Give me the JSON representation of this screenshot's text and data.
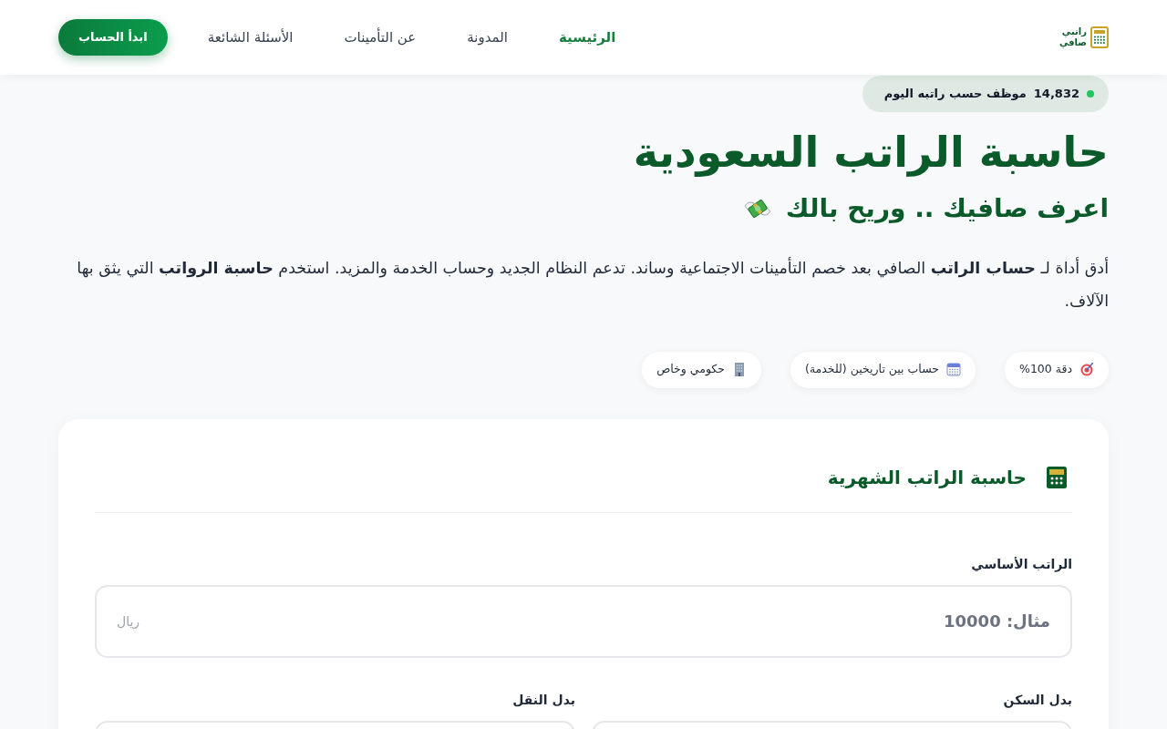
{
  "navbar": {
    "brand": {
      "lines": [
        "راتبي",
        "صافي"
      ]
    },
    "links": [
      {
        "label": "الرئيسية",
        "selected": true
      },
      {
        "label": "المدونة",
        "selected": false
      },
      {
        "label": "عن التأمينات",
        "selected": false
      },
      {
        "label": "الأسئلة الشائعة",
        "selected": false
      }
    ],
    "cta": "ابدأ الحساب"
  },
  "hero": {
    "live_badge": {
      "count": "14,832",
      "text": "موظف حسب راتبه اليوم"
    },
    "title": "حاسبة الراتب السعودية",
    "subtitle": "اعرف صافيك .. وريح بالك",
    "description": "أدق أداة لـ **حساب الراتب** الصافي بعد خصم التأمينات الاجتماعية وساند. تدعم النظام الجديد وحساب الخدمة والمزيد. استخدم **حاسبة الرواتب** التي يثق بها الآلاف.",
    "features": [
      {
        "kind": "target",
        "label": "دقة 100%"
      },
      {
        "kind": "calendar",
        "label": "حساب بين تاريخين (للخدمة)"
      },
      {
        "kind": "building",
        "label": "حكومي وخاص"
      }
    ]
  },
  "calculator": {
    "title": "حاسبة الراتب الشهرية",
    "field_rows": [
      [
        {
          "label": "الراتب الأساسي",
          "placeholder": "مثال: 10000",
          "unit": "ريال"
        }
      ],
      [
        {
          "label": "بدل السكن"
        },
        {
          "label": "بدل النقل"
        }
      ]
    ]
  }
}
